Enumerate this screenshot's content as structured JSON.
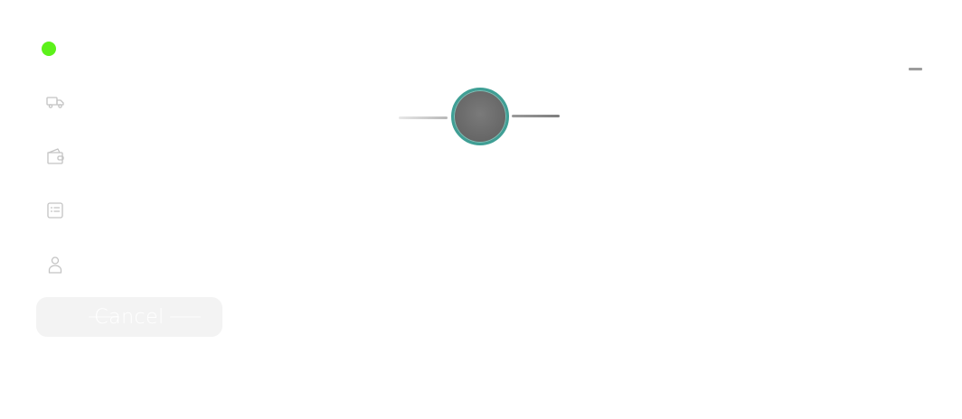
{
  "sidebar": {
    "status": {
      "color": "#5cf11a",
      "state": "online"
    },
    "items": [
      {
        "icon": "truck-icon"
      },
      {
        "icon": "wallet-icon"
      },
      {
        "icon": "list-icon"
      },
      {
        "icon": "user-icon"
      }
    ],
    "cancel_label": "Cancel"
  },
  "header": {
    "minimize_icon": "minimize-icon"
  },
  "colors": {
    "accent": "#3f9f95",
    "status_green": "#5cf11a",
    "icon_gray": "#c4c4c4",
    "button_bg": "#f3f3f3"
  }
}
